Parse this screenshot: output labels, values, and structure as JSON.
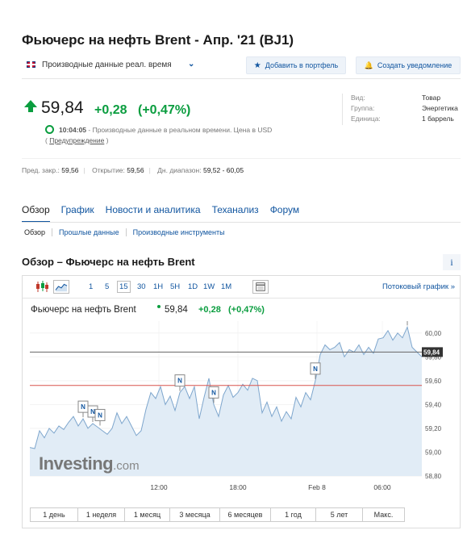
{
  "header": {
    "title": "Фьючерс на нефть Brent - Апр. '21 (BJ1)",
    "source_label": "Производные данные реал. время",
    "add_portfolio_label": "Добавить в портфель",
    "create_alert_label": "Создать уведомление"
  },
  "quote": {
    "price": "59,84",
    "change": "+0,28",
    "change_pct": "(+0,47%)",
    "time": "10:04:05",
    "realtime_text": " - Производные данные в реальном времени. Цена в USD",
    "disclaimer_open": "( ",
    "disclaimer_link": "Предупреждение",
    "disclaimer_close": " )",
    "up_color": "#0a9d3f"
  },
  "info": {
    "rows": [
      {
        "label": "Вид:",
        "value": "Товар"
      },
      {
        "label": "Группа:",
        "value": "Энергетика"
      },
      {
        "label": "Единица:",
        "value": "1 баррель"
      }
    ]
  },
  "stats": {
    "prev_close_label": "Пред. закр.:",
    "prev_close": "59,56",
    "open_label": "Открытие:",
    "open": "59,56",
    "range_label": "Дн. диапазон:",
    "range": "59,52 - 60,05"
  },
  "tabs": [
    {
      "label": "Обзор"
    },
    {
      "label": "График"
    },
    {
      "label": "Новости и аналитика"
    },
    {
      "label": "Теханализ"
    },
    {
      "label": "Форум"
    }
  ],
  "subtabs": [
    {
      "label": "Обзор"
    },
    {
      "label": "Прошлые данные"
    },
    {
      "label": "Производные инструменты"
    }
  ],
  "overview_title": "Обзор – Фьючерс на нефть Brent",
  "info_icon_label": "i",
  "toolbar": {
    "timeframes": [
      "1",
      "5",
      "15",
      "30",
      "1H",
      "5H",
      "1D",
      "1W",
      "1M"
    ],
    "selected": "15",
    "stream_label": "Потоковый график »"
  },
  "chart_header": {
    "name": "Фьючерс на нефть Brent",
    "price": "59,84",
    "change": "+0,28",
    "change_pct": "(+0,47%)"
  },
  "logo": {
    "main": "Investing",
    "suffix": ".com"
  },
  "periods": [
    "1 день",
    "1 неделя",
    "1 месяц",
    "3 месяца",
    "6 месяцев",
    "1 год",
    "5 лет",
    "Макс."
  ],
  "chart_data": {
    "type": "area",
    "x_tick_labels": [
      "12:00",
      "18:00",
      "Feb 8",
      "06:00"
    ],
    "y_tick_labels": [
      "60,00",
      "59,80",
      "59,60",
      "59,40",
      "59,20",
      "59,00",
      "58,80"
    ],
    "ylim": [
      58.8,
      60.05
    ],
    "last_price": 59.84,
    "last_price_label": "59,84",
    "prev_close": 59.56,
    "news_marker_label": "N",
    "series": [
      {
        "values": [
          59.04,
          59.03,
          59.18,
          59.12,
          59.2,
          59.16,
          59.22,
          59.19,
          59.25,
          59.3,
          59.22,
          59.28,
          59.2,
          59.24,
          59.21,
          59.18,
          59.15,
          59.2,
          59.33,
          59.24,
          59.3,
          59.22,
          59.14,
          59.18,
          59.36,
          59.5,
          59.45,
          59.55,
          59.4,
          59.47,
          59.35,
          59.5,
          59.55,
          59.45,
          59.55,
          59.28,
          59.46,
          59.62,
          59.4,
          59.3,
          59.48,
          59.56,
          59.46,
          59.5,
          59.57,
          59.52,
          59.62,
          59.6,
          59.33,
          59.42,
          59.3,
          59.38,
          59.26,
          59.34,
          59.28,
          59.46,
          59.38,
          59.5,
          59.44,
          59.6,
          59.82,
          59.9,
          59.86,
          59.88,
          59.92,
          59.8,
          59.86,
          59.84,
          59.9,
          59.82,
          59.88,
          59.83,
          59.95,
          59.96,
          60.02,
          59.94,
          60.0,
          59.96,
          60.05,
          59.88,
          59.84,
          59.8
        ]
      }
    ],
    "grid": true
  }
}
